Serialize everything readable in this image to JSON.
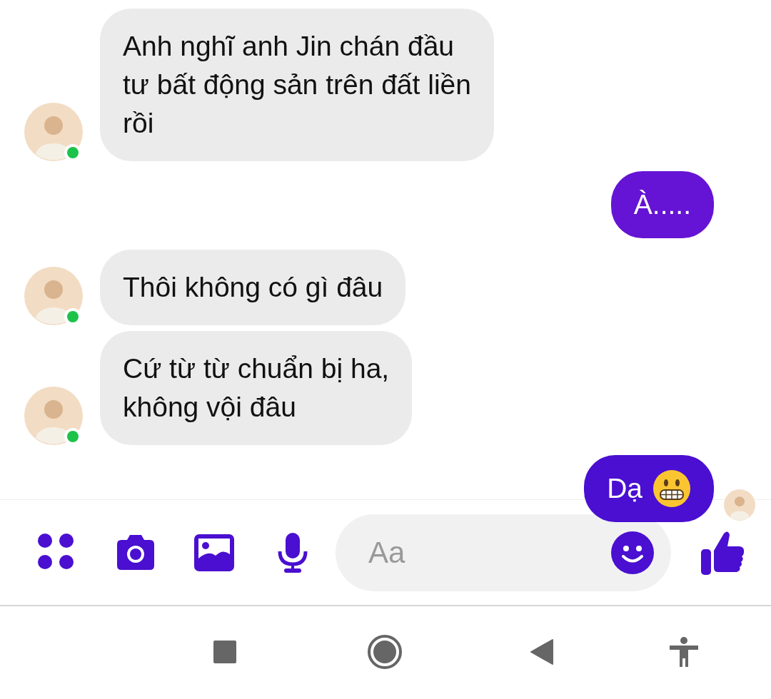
{
  "messages": [
    {
      "kind": "incoming",
      "lines": [
        "Anh nghĩ anh Jin chán đầu",
        "tư bất động sản trên đất liền",
        "rồi"
      ],
      "avatar": true,
      "online": true
    },
    {
      "kind": "outgoing",
      "lines": [
        "À....."
      ]
    },
    {
      "kind": "incoming",
      "lines": [
        "Thôi không có gì đâu"
      ],
      "avatar": true,
      "online": true
    },
    {
      "kind": "incoming",
      "lines": [
        "Cứ từ từ chuẩn bị ha,",
        "không vội đâu"
      ],
      "avatar": true,
      "online": true
    },
    {
      "kind": "outgoing",
      "lines": [
        "Dạ"
      ],
      "emoji": true,
      "seen": true
    }
  ],
  "composer": {
    "placeholder": "Aa"
  }
}
